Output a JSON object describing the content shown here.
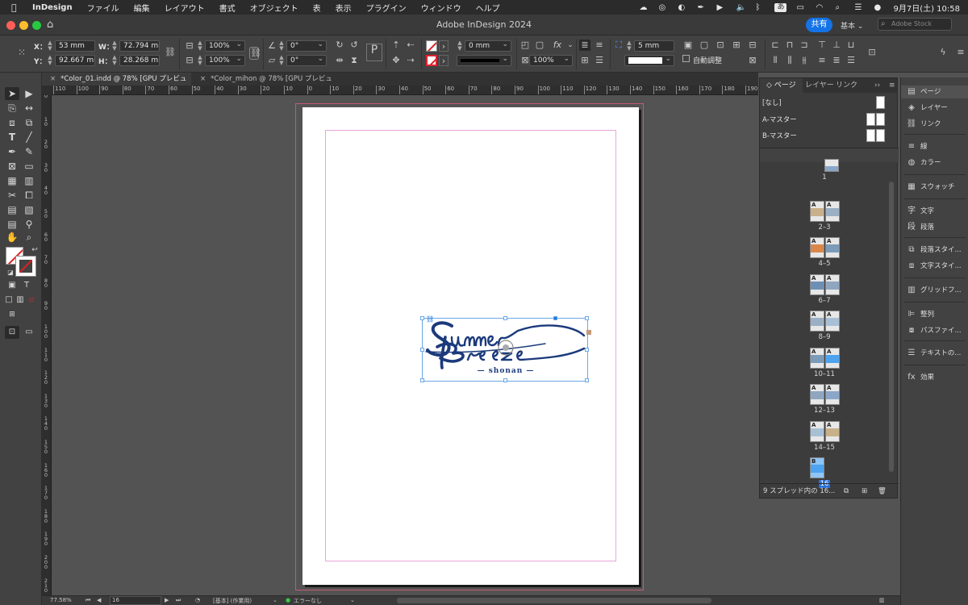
{
  "menubar": {
    "app_name": "InDesign",
    "items": [
      "ファイル",
      "編集",
      "レイアウト",
      "書式",
      "オブジェクト",
      "表",
      "表示",
      "プラグイン",
      "ウィンドウ",
      "ヘルプ"
    ],
    "ime_label": "あ",
    "datetime": "9月7日(土)  10:58"
  },
  "titlebar": {
    "title": "Adobe InDesign 2024",
    "share_label": "共有",
    "workspace_label": "基本 ⌄",
    "stock_placeholder": "Adobe Stock"
  },
  "control": {
    "x_label": "X：",
    "x_value": "53 mm",
    "y_label": "Y：",
    "y_value": "92.667 mm",
    "w_label": "W：",
    "w_value": "72.794 mm",
    "h_label": "H：",
    "h_value": "28.268 mm",
    "scale_x": "100%",
    "scale_y": "100%",
    "rotate": "0°",
    "shear": "0°",
    "stroke_weight": "0 mm",
    "opacity": "100%",
    "inset": "5 mm",
    "auto_fit_label": "自動調整"
  },
  "tabs": [
    {
      "label": "*Color_01.indd @ 78% [GPU プレビュー]",
      "close": "×"
    },
    {
      "label": "*Color_mihon @ 78% [GPU プレビュー]",
      "close": "×"
    }
  ],
  "ruler": {
    "h_ticks": [
      "110",
      "100",
      "90",
      "80",
      "70",
      "60",
      "50",
      "40",
      "30",
      "20",
      "10",
      "0",
      "10",
      "20",
      "30",
      "40",
      "50",
      "60",
      "70",
      "80",
      "90",
      "100",
      "110",
      "120",
      "130",
      "140",
      "150",
      "160",
      "170",
      "180",
      "190"
    ],
    "v_ticks": [
      "0",
      "1 0",
      "2 0",
      "3 0",
      "4 0",
      "5 0",
      "6 0",
      "7 0",
      "8 0",
      "9 0",
      "1 0 0",
      "1 1 0",
      "1 2 0",
      "1 3 0",
      "1 4 0",
      "1 5 0",
      "1 6 0",
      "1 7 0",
      "1 8 0",
      "1 9 0",
      "2 0 0",
      "2 1 0"
    ]
  },
  "logo": {
    "subtitle": "— shonan —"
  },
  "status": {
    "zoom": "77.58%",
    "page": "16",
    "style": "[基本] (作業用)",
    "preflight": "エラーなし"
  },
  "pages_panel": {
    "tabs": [
      "ページ",
      "レイヤー",
      "リンク"
    ],
    "masters": [
      "[なし]",
      "A-マスター",
      "B-マスター"
    ],
    "spreads": [
      "1",
      "2–3",
      "4–5",
      "6–7",
      "8–9",
      "10–11",
      "12–13",
      "14–15",
      "16"
    ],
    "selected_spread": "16",
    "footer": "9 スプレッド内の 16..."
  },
  "dock": {
    "items": [
      {
        "label": "ページ",
        "icon": "pages-icon"
      },
      {
        "label": "レイヤー",
        "icon": "layers-icon"
      },
      {
        "label": "リンク",
        "icon": "links-icon"
      },
      {
        "label": "線",
        "icon": "stroke-icon"
      },
      {
        "label": "カラー",
        "icon": "color-icon"
      },
      {
        "label": "スウォッチ",
        "icon": "swatches-icon"
      },
      {
        "label": "文字",
        "icon": "character-icon"
      },
      {
        "label": "段落",
        "icon": "paragraph-icon"
      },
      {
        "label": "段落スタイ...",
        "icon": "paragraph-styles-icon"
      },
      {
        "label": "文字スタイ...",
        "icon": "character-styles-icon"
      },
      {
        "label": "グリッドフ...",
        "icon": "grid-format-icon"
      },
      {
        "label": "整列",
        "icon": "align-icon"
      },
      {
        "label": "パスファイ...",
        "icon": "pathfinder-icon"
      },
      {
        "label": "テキストの...",
        "icon": "text-wrap-icon"
      },
      {
        "label": "効果",
        "icon": "effects-icon"
      }
    ]
  },
  "colors": {
    "accent": "#1473e6",
    "logo_navy": "#1b3a7c",
    "bleed": "#c45a76",
    "margin": "#e9a8d9",
    "selection": "#6aa8e8"
  }
}
